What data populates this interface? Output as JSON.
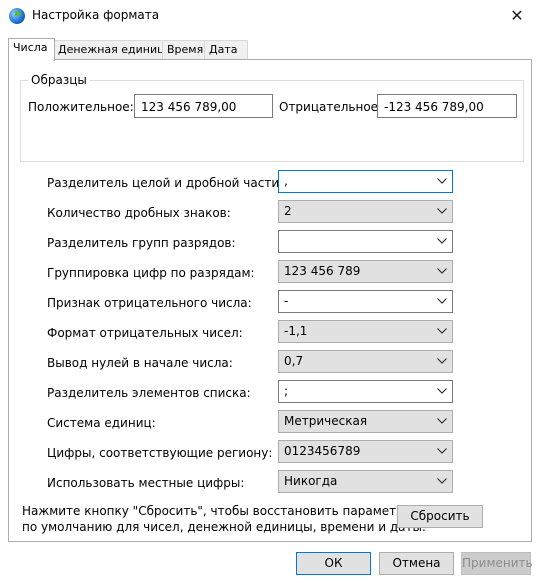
{
  "window": {
    "title": "Настройка формата",
    "close_glyph": "✕"
  },
  "tabs": [
    "Числа",
    "Денежная единица",
    "Время",
    "Дата"
  ],
  "samples": {
    "group_title": "Образцы",
    "positive_label": "Положительное:",
    "positive_value": "123 456 789,00",
    "negative_label": "Отрицательное:",
    "negative_value": "-123 456 789,00"
  },
  "settings": [
    {
      "label": "Разделитель целой и дробной части:",
      "value": ","
    },
    {
      "label": "Количество дробных знаков:",
      "value": "2"
    },
    {
      "label": "Разделитель групп разрядов:",
      "value": " "
    },
    {
      "label": "Группировка цифр по разрядам:",
      "value": "123 456 789"
    },
    {
      "label": "Признак отрицательного числа:",
      "value": "-"
    },
    {
      "label": "Формат отрицательных чисел:",
      "value": "-1,1"
    },
    {
      "label": "Вывод нулей в начале числа:",
      "value": "0,7"
    },
    {
      "label": "Разделитель элементов списка:",
      "value": ";"
    },
    {
      "label": "Система единиц:",
      "value": "Метрическая"
    },
    {
      "label": "Цифры, соответствующие региону:",
      "value": "0123456789"
    },
    {
      "label": "Использовать местные цифры:",
      "value": "Никогда"
    }
  ],
  "reset_note_line1": "Нажмите кнопку \"Сбросить\", чтобы восстановить параметры",
  "reset_note_line2": "по умолчанию для чисел, денежной единицы, времени и даты.",
  "buttons": {
    "reset": "Сбросить",
    "ok": "ОК",
    "cancel": "Отмена",
    "apply": "Применить"
  }
}
